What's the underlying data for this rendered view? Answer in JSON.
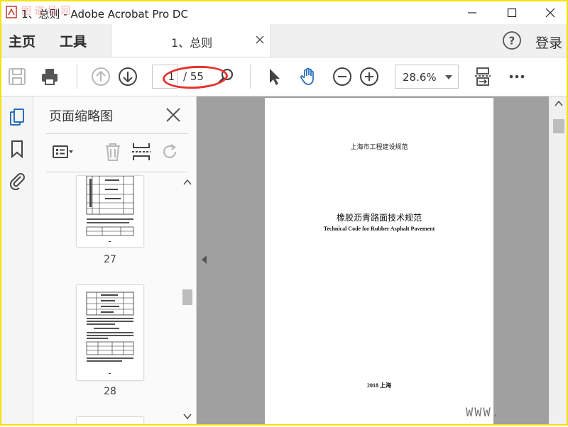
{
  "window": {
    "title": "1、总则 - Adobe Acrobat Pro DC",
    "watermark": "图 道 场 网"
  },
  "tabs": {
    "home": "主页",
    "tools": "工具",
    "document": "1、总则",
    "login": "登录"
  },
  "toolbar": {
    "page_current": "1",
    "page_total": "/ 55",
    "zoom": "28.6%",
    "annotation_color": "#e8322f"
  },
  "thumbnail_panel": {
    "title": "页面缩略图",
    "pages": [
      {
        "number": "27"
      },
      {
        "number": "28"
      }
    ]
  },
  "document": {
    "header": "上海市工程建设规范",
    "title_cn": "橡胶沥青路面技术规范",
    "title_en": "Technical Code for Rubber Asphalt Pavement",
    "footer": "2018  上海",
    "watermark": "WWW."
  },
  "colors": {
    "accent": "#2a6ebb",
    "frame": "#f2e20a",
    "annotation": "#e8322f"
  }
}
